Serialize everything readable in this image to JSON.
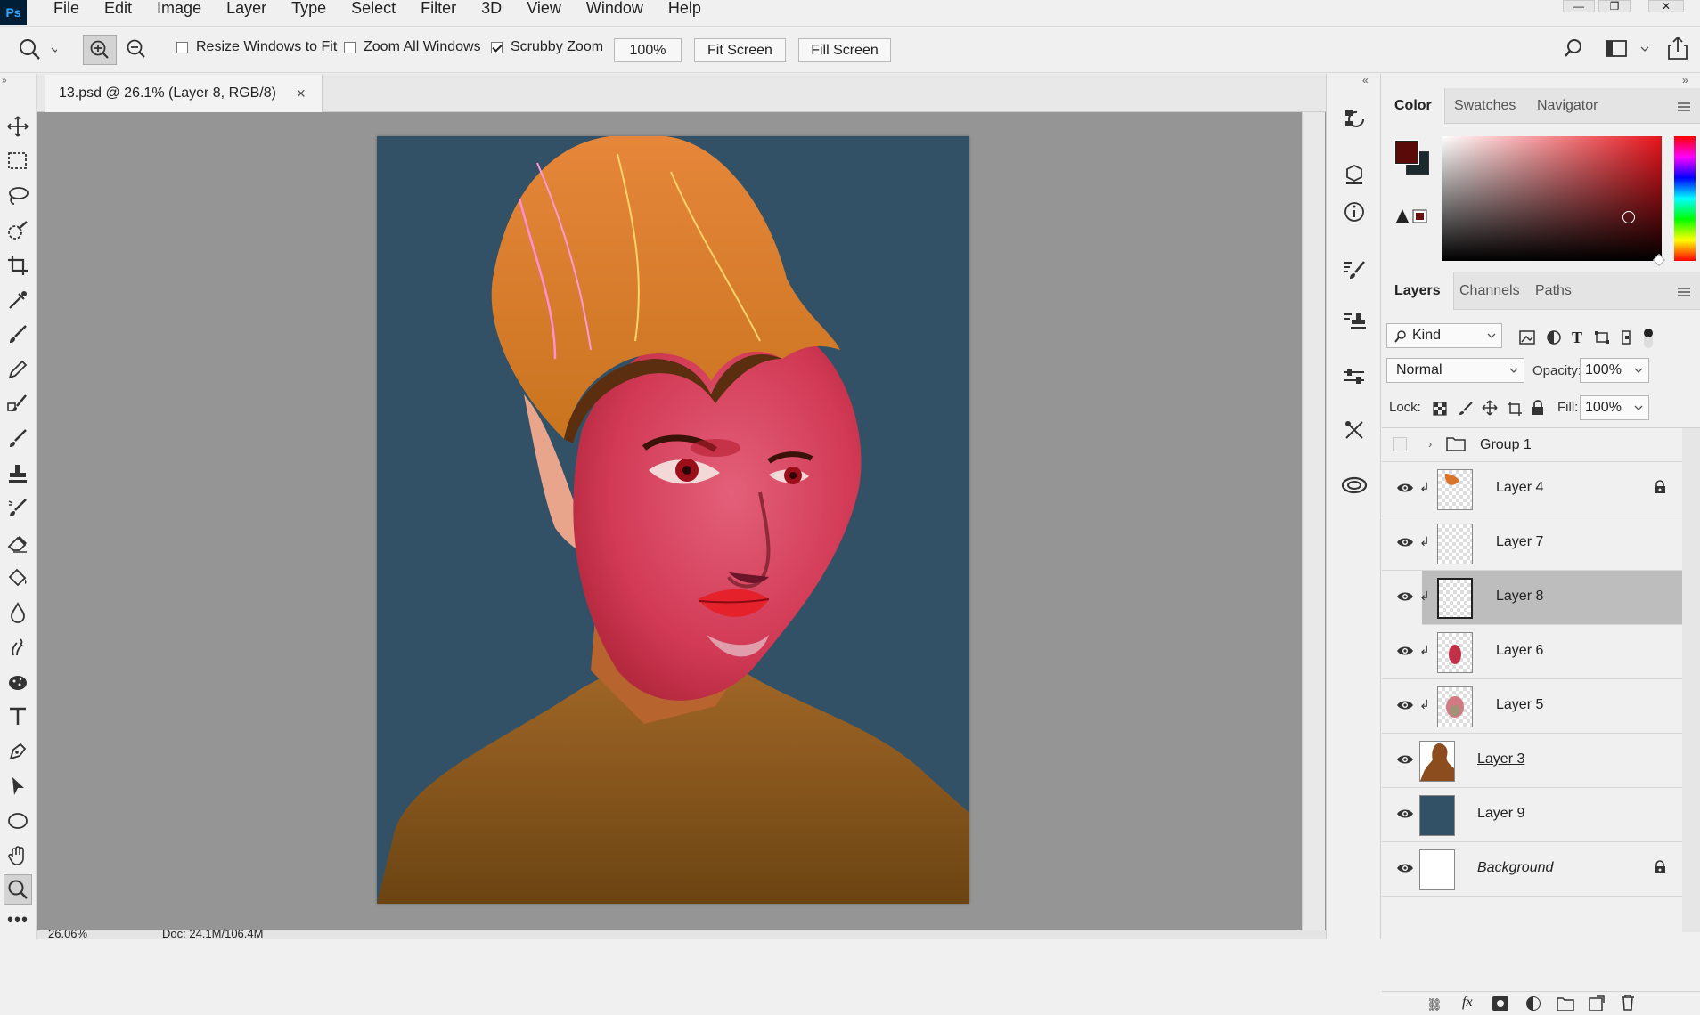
{
  "app": {
    "logo": "Ps"
  },
  "menu": [
    "File",
    "Edit",
    "Image",
    "Layer",
    "Type",
    "Select",
    "Filter",
    "3D",
    "View",
    "Window",
    "Help"
  ],
  "options": {
    "resize_windows": "Resize Windows to Fit",
    "zoom_all": "Zoom All Windows",
    "scrubby": "Scrubby Zoom",
    "zoom_value": "100%",
    "fit_screen": "Fit Screen",
    "fill_screen": "Fill Screen"
  },
  "document": {
    "tab_title": "13.psd @ 26.1% (Layer 8, RGB/8)",
    "close": "×"
  },
  "status": {
    "zoom": "26.06%",
    "doc": "Doc: 24.1M/106.4M"
  },
  "color_panel": {
    "tabs": [
      "Color",
      "Swatches",
      "Navigator"
    ],
    "foreground": "#5b0a0a",
    "background": "#1a2a2e"
  },
  "layers_panel": {
    "tabs": [
      "Layers",
      "Channels",
      "Paths"
    ],
    "filter_kind": "Kind",
    "blend_mode": "Normal",
    "opacity_label": "Opacity:",
    "opacity": "100%",
    "lock_label": "Lock:",
    "fill_label": "Fill:",
    "fill": "100%",
    "group": "Group 1",
    "layers": [
      {
        "name": "Layer 4",
        "locked": true
      },
      {
        "name": "Layer 7",
        "locked": false
      },
      {
        "name": "Layer 8",
        "locked": false,
        "selected": true
      },
      {
        "name": "Layer 6",
        "locked": false
      },
      {
        "name": "Layer 5",
        "locked": false
      },
      {
        "name": "Layer 3",
        "locked": false
      },
      {
        "name": "Layer 9",
        "locked": false
      },
      {
        "name": "Background",
        "locked": true
      }
    ]
  },
  "colors": {
    "canvas_bg": "#335166",
    "selection": "#bdbdbd"
  }
}
